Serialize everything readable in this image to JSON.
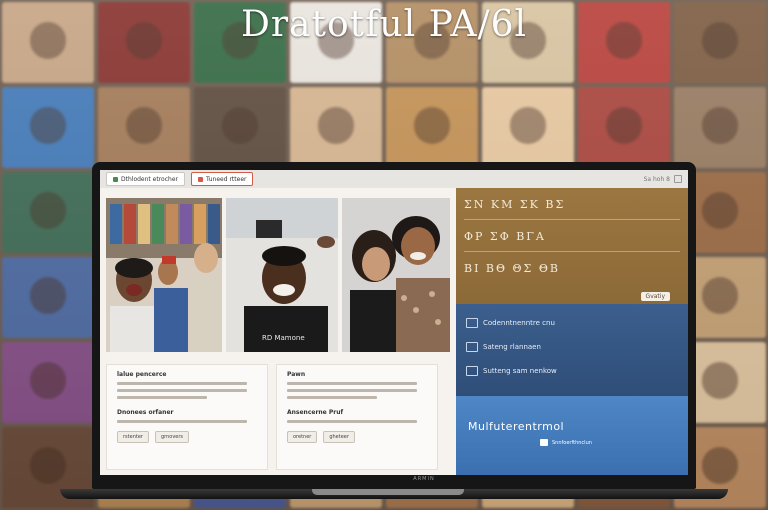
{
  "hero": {
    "title": "Dratotful PA/6l"
  },
  "browser": {
    "tabs": [
      {
        "label": "Dthlodent etrocher"
      },
      {
        "label": "Tuneed rtteer"
      }
    ],
    "top_right_text": "Sa hoh 8"
  },
  "cards": [
    {
      "title": "lalue pencerce",
      "subtitle": "Dnonees orfaner",
      "buttons": [
        "rstenter",
        "grnovers"
      ]
    },
    {
      "title": "Pawn",
      "subtitle": "Ansencerne Pruf",
      "buttons": [
        "oretner",
        "gheteer"
      ]
    }
  ],
  "shirt_text": "RD Mamone",
  "panel": {
    "rows": [
      "ΣΝ  ΚΜ  ΣΚ  ΒΣ",
      "ΦΡ  ΣΦ  ΒΓΑ",
      "ΒΙ  ΒΘ  ΘΣ  ΘΒ"
    ],
    "badge": "Gvatiy",
    "mid_rows": [
      "Codenntnenntre cnu",
      "Sateng rlannaen",
      "Sutteng sam nenkow"
    ],
    "banner_title": "Mulfuterentrmol",
    "banner_sub": "Snnfoerfthnclun"
  },
  "laptop_brand": "ARMIN"
}
